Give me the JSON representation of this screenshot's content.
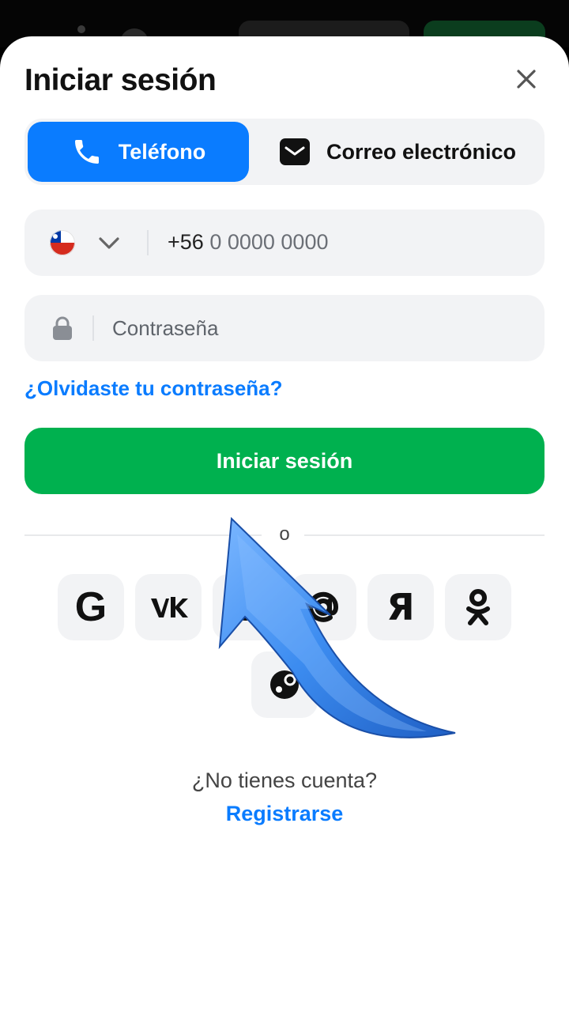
{
  "header": {
    "title": "Iniciar sesión"
  },
  "tabs": [
    {
      "label": "Teléfono",
      "icon": "phone-icon",
      "active": true
    },
    {
      "label": "Correo electrónico",
      "icon": "envelope-icon",
      "active": false
    }
  ],
  "phone": {
    "country_code": "+56",
    "placeholder": "0 0000 0000",
    "country": "Chile"
  },
  "password": {
    "placeholder": "Contraseña"
  },
  "forgot_label": "¿Olvidaste tu contraseña?",
  "login_button": "Iniciar sesión",
  "separator": "o",
  "social": {
    "google": "G",
    "yandex": "Я"
  },
  "footer": {
    "question": "¿No tienes cuenta?",
    "register": "Registrarse"
  },
  "colors": {
    "accent": "#0a7cff",
    "primary": "#00b14f",
    "field_bg": "#f2f3f5",
    "arrow": "#3c8cf0"
  }
}
